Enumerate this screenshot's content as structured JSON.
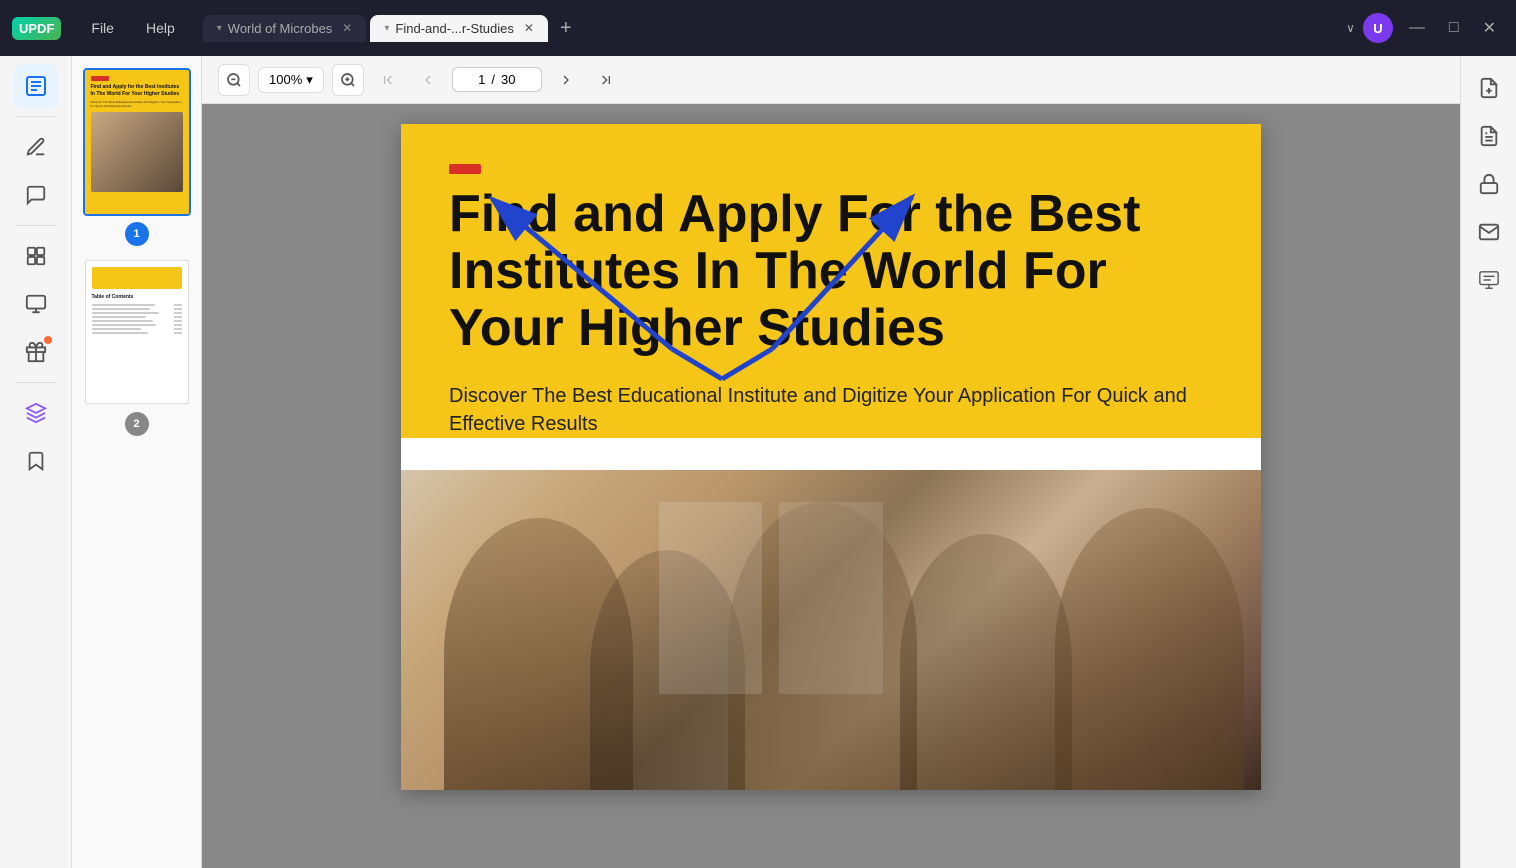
{
  "app": {
    "logo": "UPDF",
    "menu": [
      "File",
      "Help"
    ]
  },
  "tabs": [
    {
      "id": "tab1",
      "label": "World of Microbes",
      "active": false
    },
    {
      "id": "tab2",
      "label": "Find-and-...r-Studies",
      "active": true
    }
  ],
  "toolbar": {
    "zoom_level": "100%",
    "zoom_dropdown_arrow": "▾",
    "page_current": "1",
    "page_separator": "/",
    "page_total": "30",
    "zoom_out_label": "−",
    "zoom_in_label": "+"
  },
  "pdf": {
    "brand_text": "",
    "main_title": "Find and Apply For the Best Institutes In The World For Your Higher Studies",
    "subtitle": "Discover The Best Educational Institute and Digitize Your Application For Quick and Effective Results"
  },
  "thumbnails": [
    {
      "page_num": "1",
      "selected": true
    },
    {
      "page_num": "2",
      "selected": false
    }
  ],
  "sidebar": {
    "icons": [
      {
        "name": "reader-icon",
        "symbol": "📖",
        "active": true
      },
      {
        "name": "edit-icon",
        "symbol": "✏️",
        "active": false
      },
      {
        "name": "comment-icon",
        "symbol": "💬",
        "active": false
      },
      {
        "name": "organize-icon",
        "symbol": "📋",
        "active": false
      },
      {
        "name": "crop-icon",
        "symbol": "⊞",
        "active": false
      },
      {
        "name": "gift-icon",
        "symbol": "🎁",
        "active": false,
        "dot": true
      },
      {
        "name": "layers-icon",
        "symbol": "⊕",
        "active": false
      },
      {
        "name": "bookmark-icon",
        "symbol": "🔖",
        "active": false
      }
    ]
  },
  "right_toolbar": {
    "icons": [
      {
        "name": "attachment-icon",
        "symbol": "📎"
      },
      {
        "name": "pdf-icon",
        "symbol": "📄"
      },
      {
        "name": "lock-icon",
        "symbol": "🔒"
      },
      {
        "name": "mail-icon",
        "symbol": "✉️"
      },
      {
        "name": "ocr-icon",
        "symbol": "OCR"
      }
    ]
  },
  "user": {
    "avatar_letter": "U",
    "avatar_color": "#7c3aed"
  }
}
